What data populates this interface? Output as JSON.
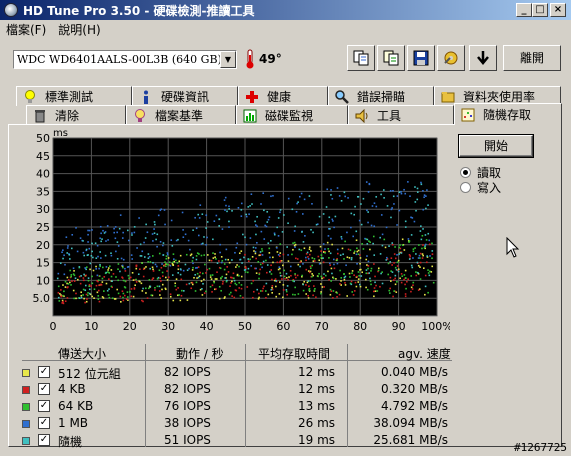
{
  "window": {
    "title": "HD Tune Pro 3.50 - 硬碟檢測-推讀工具"
  },
  "menu": [
    {
      "label": "檔案(F)"
    },
    {
      "label": "說明(H)"
    }
  ],
  "toolbar": {
    "drive": "WDC WD6401AALS-00L3B (640 GB)",
    "temperature": "49°",
    "exit_label": "離開",
    "icons": [
      "copy-icon",
      "copy-info-icon",
      "save-icon",
      "options-icon",
      "download-icon"
    ]
  },
  "tabs": {
    "row1": [
      {
        "label": "標準測試",
        "icon": "bulb-icon"
      },
      {
        "label": "硬碟資訊",
        "icon": "info-icon"
      },
      {
        "label": "健康",
        "icon": "health-icon"
      },
      {
        "label": "錯誤掃瞄",
        "icon": "magnifier-icon"
      },
      {
        "label": "資料夾使用率",
        "icon": "folder-icon"
      }
    ],
    "row2": [
      {
        "label": "清除",
        "icon": "trash-icon"
      },
      {
        "label": "檔案基準",
        "icon": "file-bench-icon"
      },
      {
        "label": "磁碟監視",
        "icon": "monitor-icon"
      },
      {
        "label": "工具",
        "icon": "speaker-icon"
      },
      {
        "label": "隨機存取",
        "icon": "random-icon",
        "active": true
      }
    ]
  },
  "controls": {
    "start_label": "開始",
    "read_label": "讀取",
    "write_label": "寫入",
    "selected": "read"
  },
  "chart_data": {
    "type": "scatter",
    "ylabel": "ms",
    "ylim": [
      0,
      50
    ],
    "y_ticks": [
      "50",
      "45",
      "40",
      "35",
      "30",
      "25",
      "20",
      "15",
      "10",
      "5.0"
    ],
    "x_ticks": [
      "0",
      "10",
      "20",
      "30",
      "40",
      "50",
      "60",
      "70",
      "80",
      "90",
      "100%"
    ],
    "xlim": [
      0,
      100
    ],
    "grid": true,
    "series": [
      {
        "name": "512 位元組",
        "color": "#e8e84a",
        "avg_ms": 12,
        "min_ms": 3,
        "max_ms": 23
      },
      {
        "name": "4 KB",
        "color": "#d02020",
        "avg_ms": 12,
        "min_ms": 3,
        "max_ms": 21
      },
      {
        "name": "64 KB",
        "color": "#30c030",
        "avg_ms": 13,
        "min_ms": 4,
        "max_ms": 24
      },
      {
        "name": "1 MB",
        "color": "#3070d0",
        "avg_ms": 26,
        "min_ms": 10,
        "max_ms": 40
      },
      {
        "name": "隨機",
        "color": "#40c0c0",
        "avg_ms": 19,
        "min_ms": 4,
        "max_ms": 38
      }
    ]
  },
  "table": {
    "headers": [
      "傳送大小",
      "動作 / 秒",
      "平均存取時間",
      "agv. 速度"
    ],
    "rows": [
      {
        "size": "512 位元組",
        "iops": "82 IOPS",
        "access": "12 ms",
        "speed": "0.040 MB/s",
        "color": "#e8e84a"
      },
      {
        "size": "4 KB",
        "iops": "82 IOPS",
        "access": "12 ms",
        "speed": "0.320 MB/s",
        "color": "#d02020"
      },
      {
        "size": "64 KB",
        "iops": "76 IOPS",
        "access": "13 ms",
        "speed": "4.792 MB/s",
        "color": "#30c030"
      },
      {
        "size": "1 MB",
        "iops": "38 IOPS",
        "access": "26 ms",
        "speed": "38.094 MB/s",
        "color": "#3070d0"
      },
      {
        "size": "隨機",
        "iops": "51 IOPS",
        "access": "19 ms",
        "speed": "25.681 MB/s",
        "color": "#40c0c0"
      }
    ]
  },
  "watermark": "#1267725"
}
